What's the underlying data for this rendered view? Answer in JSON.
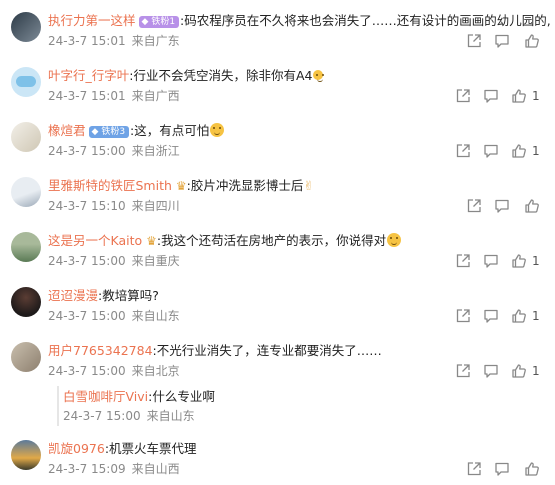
{
  "comments": [
    {
      "name": "执行力第一这样",
      "badge": "铁粉1",
      "badge_color": "purple",
      "text": ":码农程序员在不久将来也会消失了……还有设计的画画的幼儿园的,",
      "date": "24-3-7 15:01",
      "loc": "来自广东",
      "likes": "",
      "emoji": "",
      "avatar_colors": [
        "#2d3b47",
        "#7d8a96"
      ]
    },
    {
      "name": "叶字行_行字叶",
      "badge": "",
      "text": ":行业不会凭空消失，除非你有A4",
      "date": "24-3-7 15:01",
      "loc": "来自广西",
      "likes": "1",
      "emoji": "smile",
      "avatar_colors": [
        "#cbe6f6",
        "#7ec1e8"
      ]
    },
    {
      "name": "橡煊君",
      "badge": "铁粉3",
      "badge_color": "blue",
      "text": ":这，有点可怕",
      "date": "24-3-7 15:00",
      "loc": "来自浙江",
      "likes": "1",
      "emoji": "scared",
      "avatar_colors": [
        "#f2efe8",
        "#cfc7b4"
      ]
    },
    {
      "name": "里雅斯特的铁匠Smith",
      "badge": "",
      "text": ":胶片冲洗显影博士后",
      "date": "24-3-7 15:10",
      "loc": "来自四川",
      "likes": "",
      "emoji": "crown",
      "emoji2": "victory",
      "avatar_colors": [
        "#e8edf2",
        "#9aa8b7"
      ]
    },
    {
      "name": "这是另一个Kaito",
      "badge": "",
      "text": ":我这个还苟活在房地产的表示，你说得对",
      "date": "24-3-7 15:00",
      "loc": "来自重庆",
      "likes": "1",
      "emoji": "crown",
      "emoji2": "smile",
      "avatar_colors": [
        "#5a7a55",
        "#a8b99a"
      ]
    },
    {
      "name": "迢迢漫漫",
      "badge": "",
      "text": ":教培算吗?",
      "date": "24-3-7 15:00",
      "loc": "来自山东",
      "likes": "1",
      "emoji": "",
      "avatar_colors": [
        "#1e1a1a",
        "#5b3d34"
      ]
    },
    {
      "name": "用户7765342784",
      "badge": "",
      "text": ":不光行业消失了，连专业都要消失了……",
      "date": "24-3-7 15:00",
      "loc": "来自北京",
      "likes": "1",
      "emoji": "",
      "avatar_colors": [
        "#8d7f6e",
        "#c9bfae"
      ]
    },
    {
      "name": "凯旋0976",
      "badge": "",
      "text": ":机票火车票代理",
      "date": "24-3-7 15:09",
      "loc": "来自山西",
      "likes": "",
      "emoji": "",
      "avatar_colors": [
        "#e1a948",
        "#5b7a9b"
      ]
    }
  ],
  "reply": {
    "name": "白雪咖啡厅Vivi",
    "text": ":什么专业啊",
    "date": "24-3-7 15:00",
    "loc": "来自山东"
  },
  "icons": [
    "share-icon",
    "comment-icon",
    "like-icon"
  ],
  "colors": {
    "name": "#eb7350",
    "meta": "#8a8a8a",
    "text": "#222222"
  }
}
